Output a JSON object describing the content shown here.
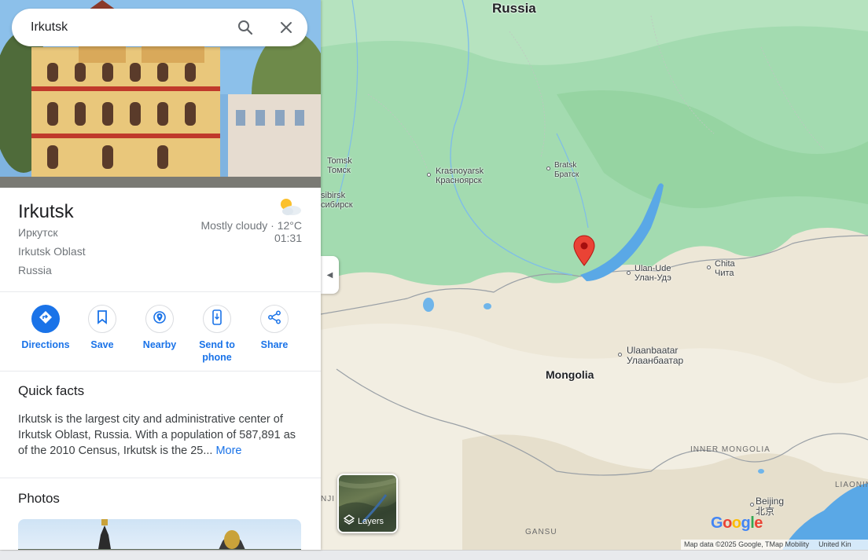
{
  "search": {
    "value": "Irkutsk"
  },
  "place": {
    "name": "Irkutsk",
    "native_name": "Иркутск",
    "region": "Irkutsk Oblast",
    "country": "Russia",
    "weather": "Mostly cloudy · 12°C",
    "time": "01:31"
  },
  "actions": [
    {
      "label": "Directions",
      "icon": "directions-icon"
    },
    {
      "label": "Save",
      "icon": "bookmark-icon"
    },
    {
      "label": "Nearby",
      "icon": "nearby-icon"
    },
    {
      "label": "Send to phone",
      "icon": "phone-icon"
    },
    {
      "label": "Share",
      "icon": "share-icon"
    }
  ],
  "quick_facts": {
    "title": "Quick facts",
    "text": "Irkutsk is the largest city and administrative center of Irkutsk Oblast, Russia. With a population of 587,891 as of the 2010 Census, Irkutsk is the 25...",
    "more": "More"
  },
  "photos": {
    "title": "Photos"
  },
  "map": {
    "labels": {
      "russia": "Russia",
      "mongolia": "Mongolia",
      "tomsk": "Tomsk",
      "tomsk_native": "Томск",
      "krasnoyarsk": "Krasnoyarsk",
      "krasnoyarsk_native": "Красноярск",
      "bratsk": "Bratsk",
      "bratsk_native": "Братск",
      "novosibirsk_part": "sibirsk",
      "novosibirsk_native_part": "сибирск",
      "ulan_ude": "Ulan-Ude",
      "ulan_ude_native": "Улан-Удэ",
      "chita": "Chita",
      "chita_native": "Чита",
      "ulaanbaatar": "Ulaanbaatar",
      "ulaanbaatar_native": "Улаанбаатар",
      "inner_mongolia": "INNER MONGOLIA",
      "liaoning": "LIAONING",
      "gansu": "GANSU",
      "ningxia_part": "NJI",
      "beijing": "Beijing",
      "beijing_native": "北京"
    },
    "layers_label": "Layers",
    "google_logo": "Google",
    "attribution": "Map data ©2025 Google, TMap Mobility",
    "attribution_country": "United Kin",
    "colors": {
      "forest": "#9fd9a8",
      "steppe": "#ece6d6",
      "water": "#5aa8e6",
      "pin": "#ea4335"
    }
  }
}
